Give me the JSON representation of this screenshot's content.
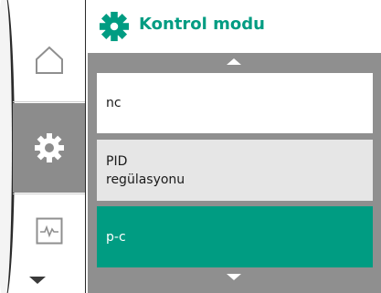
{
  "header": {
    "title": "Kontrol modu",
    "icon": "settings-gear-icon",
    "title_color": "#009c82"
  },
  "rail": {
    "items": [
      {
        "icon": "home-icon",
        "selected": false
      },
      {
        "icon": "settings-gear-icon",
        "selected": true
      },
      {
        "icon": "diagnostics-icon",
        "selected": false
      }
    ],
    "scroll_down_icon": "arrow-down-icon"
  },
  "menu": {
    "scroll_up_icon": "arrow-up-icon",
    "scroll_down_icon": "arrow-down-icon",
    "items": [
      {
        "label": "nc",
        "selected": false
      },
      {
        "label": "PID\nregülasyonu",
        "selected": false
      },
      {
        "label": "p-c",
        "selected": true
      }
    ],
    "accent_color": "#009c82"
  }
}
